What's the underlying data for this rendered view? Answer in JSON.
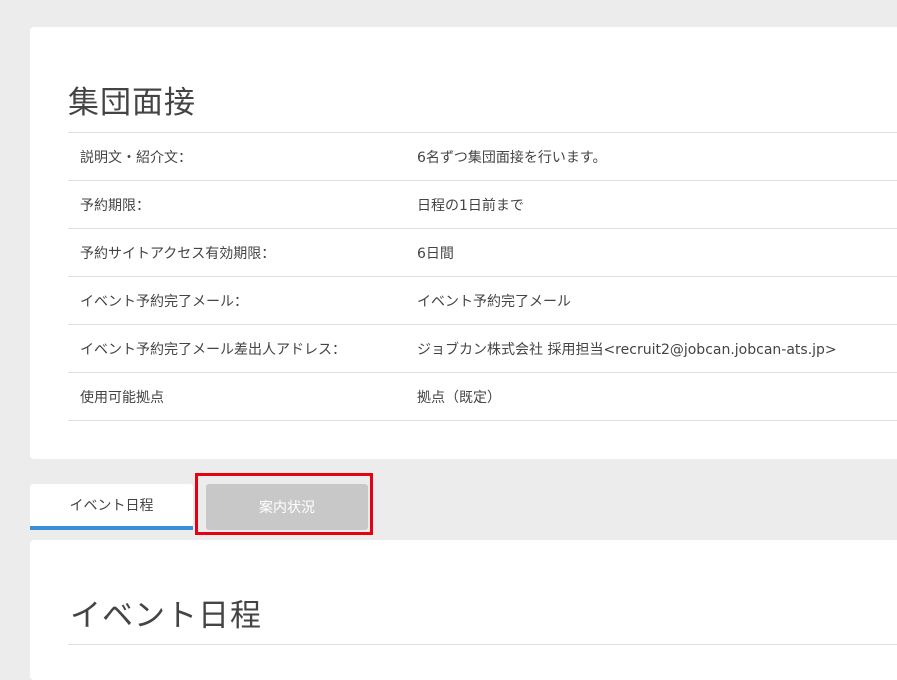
{
  "event": {
    "title": "集団面接",
    "rows": [
      {
        "label": "説明文・紹介文：",
        "value": "6名ずつ集団面接を行います。"
      },
      {
        "label": "予約期限：",
        "value": "日程の1日前まで"
      },
      {
        "label": "予約サイトアクセス有効期限：",
        "value": "6日間"
      },
      {
        "label": "イベント予約完了メール：",
        "value": "イベント予約完了メール"
      },
      {
        "label": "イベント予約完了メール差出人アドレス：",
        "value": "ジョブカン株式会社 採用担当<recruit2@jobcan.jobcan-ats.jp>"
      },
      {
        "label": "使用可能拠点",
        "value": "拠点（既定）"
      }
    ]
  },
  "tabs": [
    {
      "label": "イベント日程",
      "active": true
    },
    {
      "label": "案内状況",
      "active": false
    }
  ],
  "schedule": {
    "title": "イベント日程"
  },
  "colors": {
    "tab_underline": "#3a90d8",
    "highlight_outline": "#e60012",
    "inactive_tab": "#c8c8c8"
  }
}
